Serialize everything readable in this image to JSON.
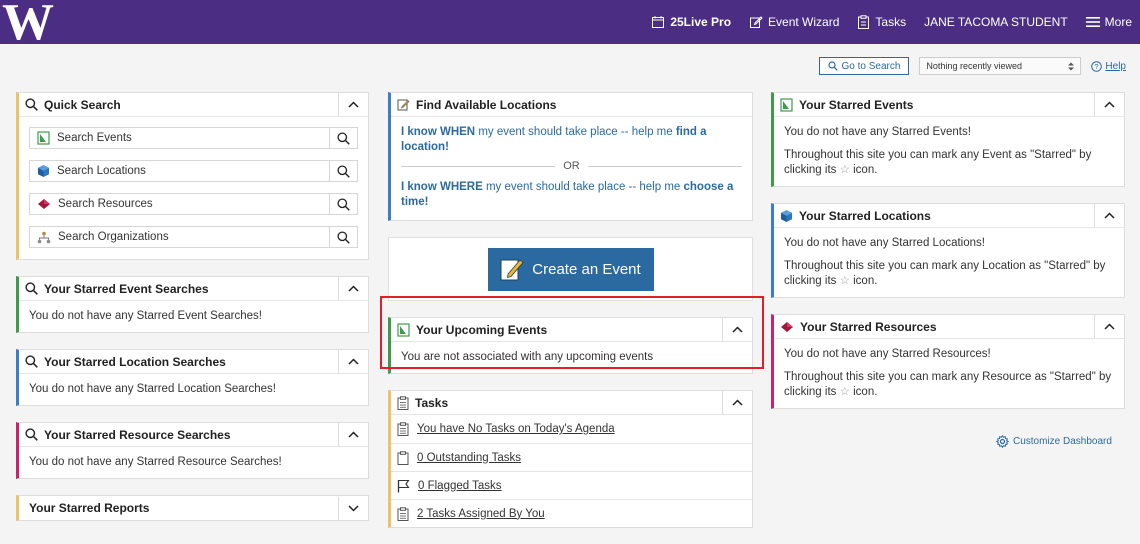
{
  "header": {
    "logo": "W",
    "nav": [
      {
        "label": "25Live Pro"
      },
      {
        "label": "Event Wizard"
      },
      {
        "label": "Tasks"
      },
      {
        "label": "JANE TACOMA STUDENT"
      },
      {
        "label": "More"
      }
    ]
  },
  "util": {
    "go_to_search": "Go to Search",
    "recent": "Nothing recently viewed",
    "help": "Help"
  },
  "quick_search": {
    "title": "Quick Search",
    "rows": [
      {
        "label": "Search Events",
        "icon": "event-icon"
      },
      {
        "label": "Search Locations",
        "icon": "location-cube-icon"
      },
      {
        "label": "Search Resources",
        "icon": "resource-diamond-icon"
      },
      {
        "label": "Search Organizations",
        "icon": "organization-icon"
      }
    ]
  },
  "starred_event_searches": {
    "title": "Your Starred Event Searches",
    "empty": "You do not have any Starred Event Searches!"
  },
  "starred_location_searches": {
    "title": "Your Starred Location Searches",
    "empty": "You do not have any Starred Location Searches!"
  },
  "starred_resource_searches": {
    "title": "Your Starred Resource Searches",
    "empty": "You do not have any Starred Resource Searches!"
  },
  "starred_reports": {
    "title": "Your Starred Reports"
  },
  "find_locations": {
    "title": "Find Available Locations",
    "line1_a": "I know WHEN",
    "line1_b": " my event should take place -- help me ",
    "line1_c": "find a location!",
    "or": "OR",
    "line2_a": "I know WHERE",
    "line2_b": " my event should take place -- help me ",
    "line2_c": "choose a time!"
  },
  "create_event": {
    "label": "Create an Event"
  },
  "upcoming": {
    "title": "Your Upcoming Events",
    "empty": "You are not associated with any upcoming events"
  },
  "tasks": {
    "title": "Tasks",
    "rows": [
      {
        "label": "You have No Tasks on Today's Agenda",
        "icon": "agenda-icon"
      },
      {
        "label": "0 Outstanding Tasks",
        "icon": "clipboard-icon"
      },
      {
        "label": "0 Flagged Tasks",
        "icon": "flag-icon"
      },
      {
        "label": "2 Tasks Assigned By You",
        "icon": "assigned-icon"
      }
    ]
  },
  "starred_events": {
    "title": "Your Starred Events",
    "empty": "You do not have any Starred Events!",
    "hint_a": "Throughout this site you can mark any Event as \"Starred\" by clicking its",
    "hint_b": "icon."
  },
  "starred_locations": {
    "title": "Your Starred Locations",
    "empty": "You do not have any Starred Locations!",
    "hint_a": "Throughout this site you can mark any Location as \"Starred\" by clicking its",
    "hint_b": "icon."
  },
  "starred_resources": {
    "title": "Your Starred Resources",
    "empty": "You do not have any Starred Resources!",
    "hint_a": "Throughout this site you can mark any Resource as \"Starred\" by clicking its",
    "hint_b": "icon."
  },
  "customize": {
    "label": "Customize Dashboard"
  },
  "colors": {
    "header": "#4b2e83",
    "accent": "#2b6aa0",
    "highlight": "#e21e26"
  }
}
